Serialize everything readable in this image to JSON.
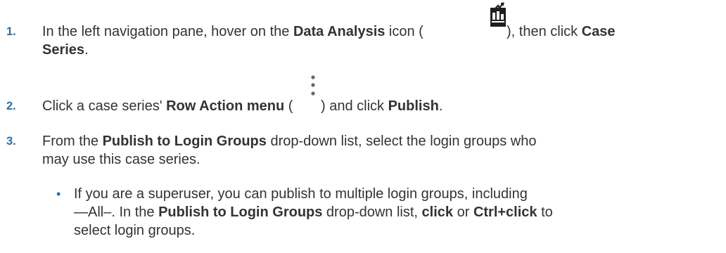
{
  "steps": [
    {
      "number": "1.",
      "t1": "In the left navigation pane, hover on the ",
      "b1": "Data Analysis",
      "t2": " icon (",
      "icon": "data-analysis-icon",
      "t3": "), then click ",
      "b2": "Case",
      "b3": "Series",
      "t4": "."
    },
    {
      "number": "2.",
      "t1": "Click a case series' ",
      "b1": "Row Action menu",
      "t2": " (",
      "icon": "more-vertical-icon",
      "t3": ") and click ",
      "b2": "Publish",
      "t4": "."
    },
    {
      "number": "3.",
      "t1": "From the ",
      "b1": "Publish to Login Groups",
      "t2": " drop-down list, select the login groups who",
      "line2": "may use this case series."
    }
  ],
  "bullet": {
    "glyph": "•",
    "line1": "If you are a superuser, you can publish to multiple login groups, including",
    "l2_t1": "—All–. In the ",
    "l2_b1": "Publish to Login Groups",
    "l2_t2": " drop-down list, ",
    "l2_b2": "click",
    "l2_t3": " or ",
    "l2_b3": "Ctrl+click",
    "l2_t4": " to",
    "line3": "select login groups."
  },
  "colors": {
    "accent": "#2d6fa5",
    "text": "#333333",
    "icon_dark": "#1f1f1f"
  }
}
